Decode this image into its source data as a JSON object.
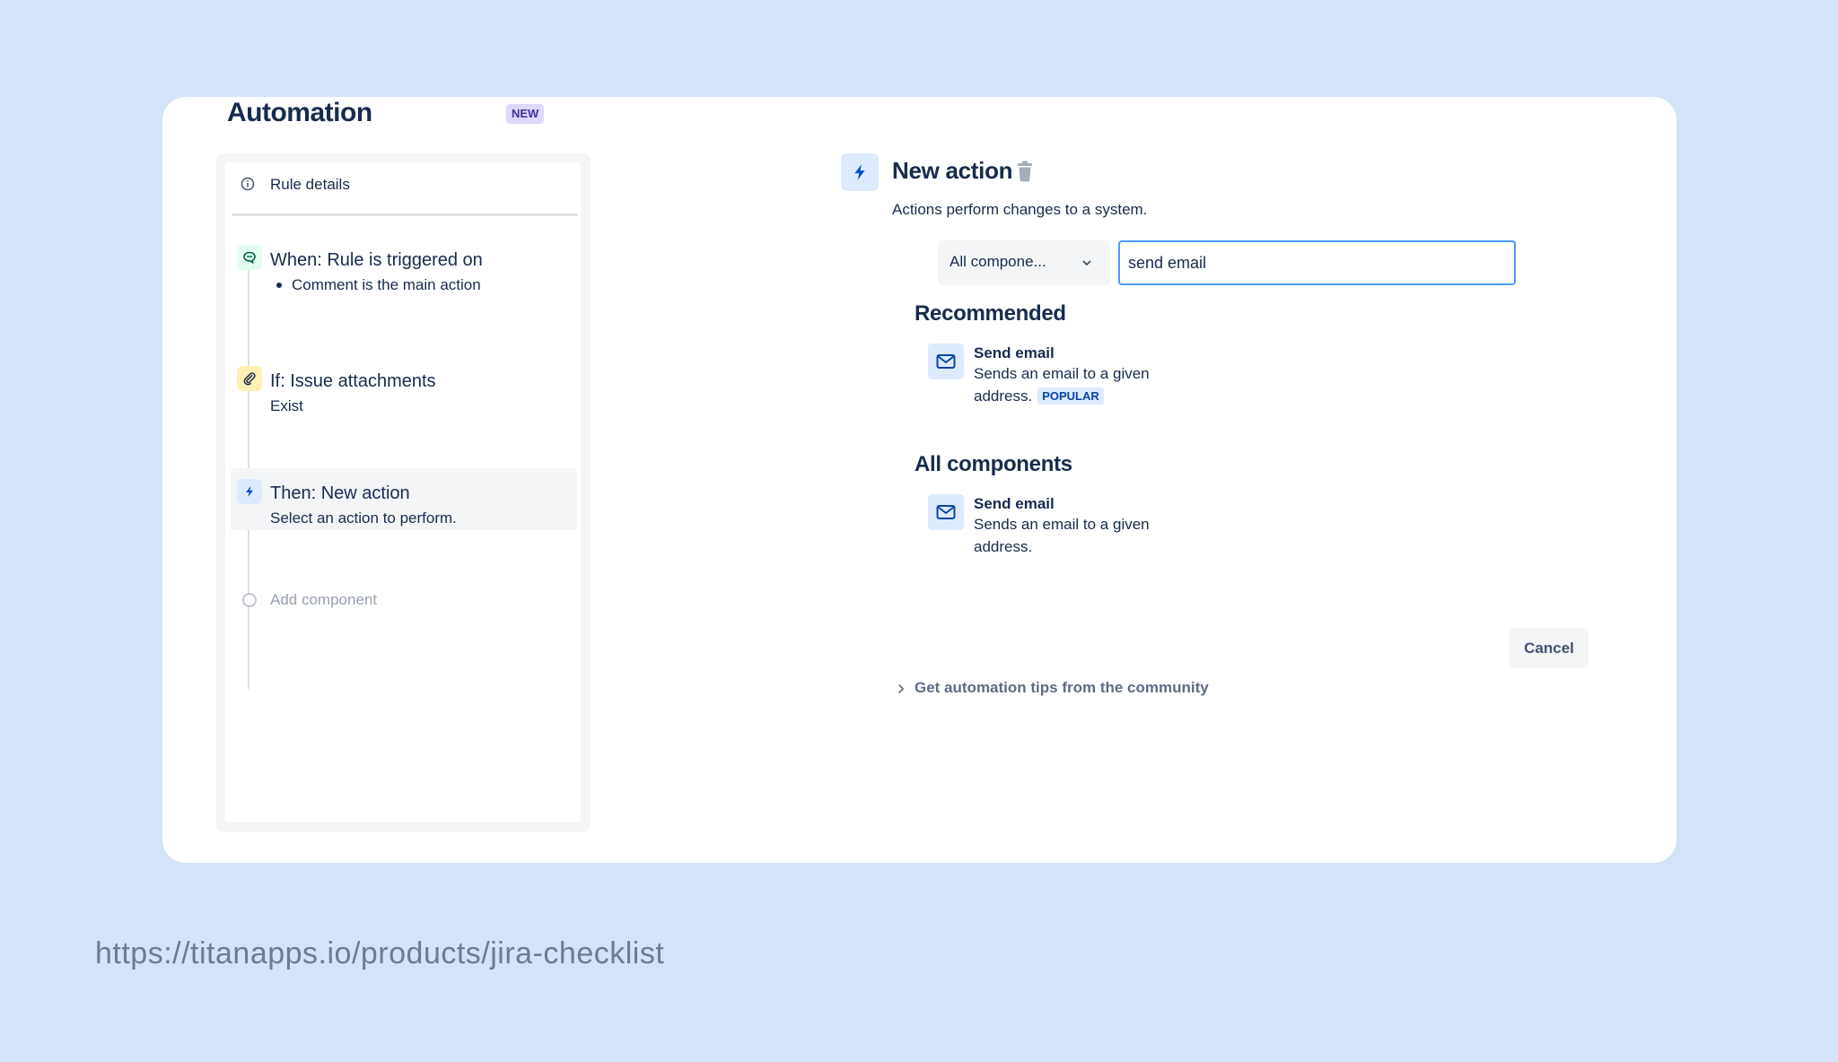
{
  "header": {
    "title": "Automation",
    "badge": "NEW"
  },
  "sidebar": {
    "rule_details": {
      "label": "Rule details",
      "icon": "info-icon"
    },
    "steps": [
      {
        "title": "When: Rule is triggered on",
        "bullet": "Comment is the main action",
        "icon": "comment-icon",
        "color": "#e3fcef"
      },
      {
        "title": "If: Issue attachments",
        "subtitle": "Exist",
        "icon": "paperclip-icon",
        "color": "#fff0b3"
      },
      {
        "title": "Then: New action",
        "subtitle": "Select an action to perform.",
        "icon": "lightning-icon",
        "color": "#deebff"
      }
    ],
    "add_component": "Add component"
  },
  "panel": {
    "title": "New action",
    "description": "Actions perform changes to a system.",
    "filter": {
      "selected": "All compone..."
    },
    "search": {
      "value": "send email",
      "placeholder": ""
    },
    "recommended": {
      "heading": "Recommended",
      "item": {
        "title": "Send email",
        "description": "Sends an email to a given address.",
        "badge": "POPULAR"
      }
    },
    "all_components": {
      "heading": "All components",
      "item": {
        "title": "Send email",
        "description": "Sends an email to a given address."
      }
    },
    "cancel_label": "Cancel",
    "tips_label": "Get automation tips from the community"
  },
  "footer": {
    "url": "https://titanapps.io/products/jira-checklist"
  },
  "colors": {
    "background": "#d4e3f8",
    "text": "#172b4d",
    "accent": "#0052cc",
    "focus": "#4c9aff"
  }
}
